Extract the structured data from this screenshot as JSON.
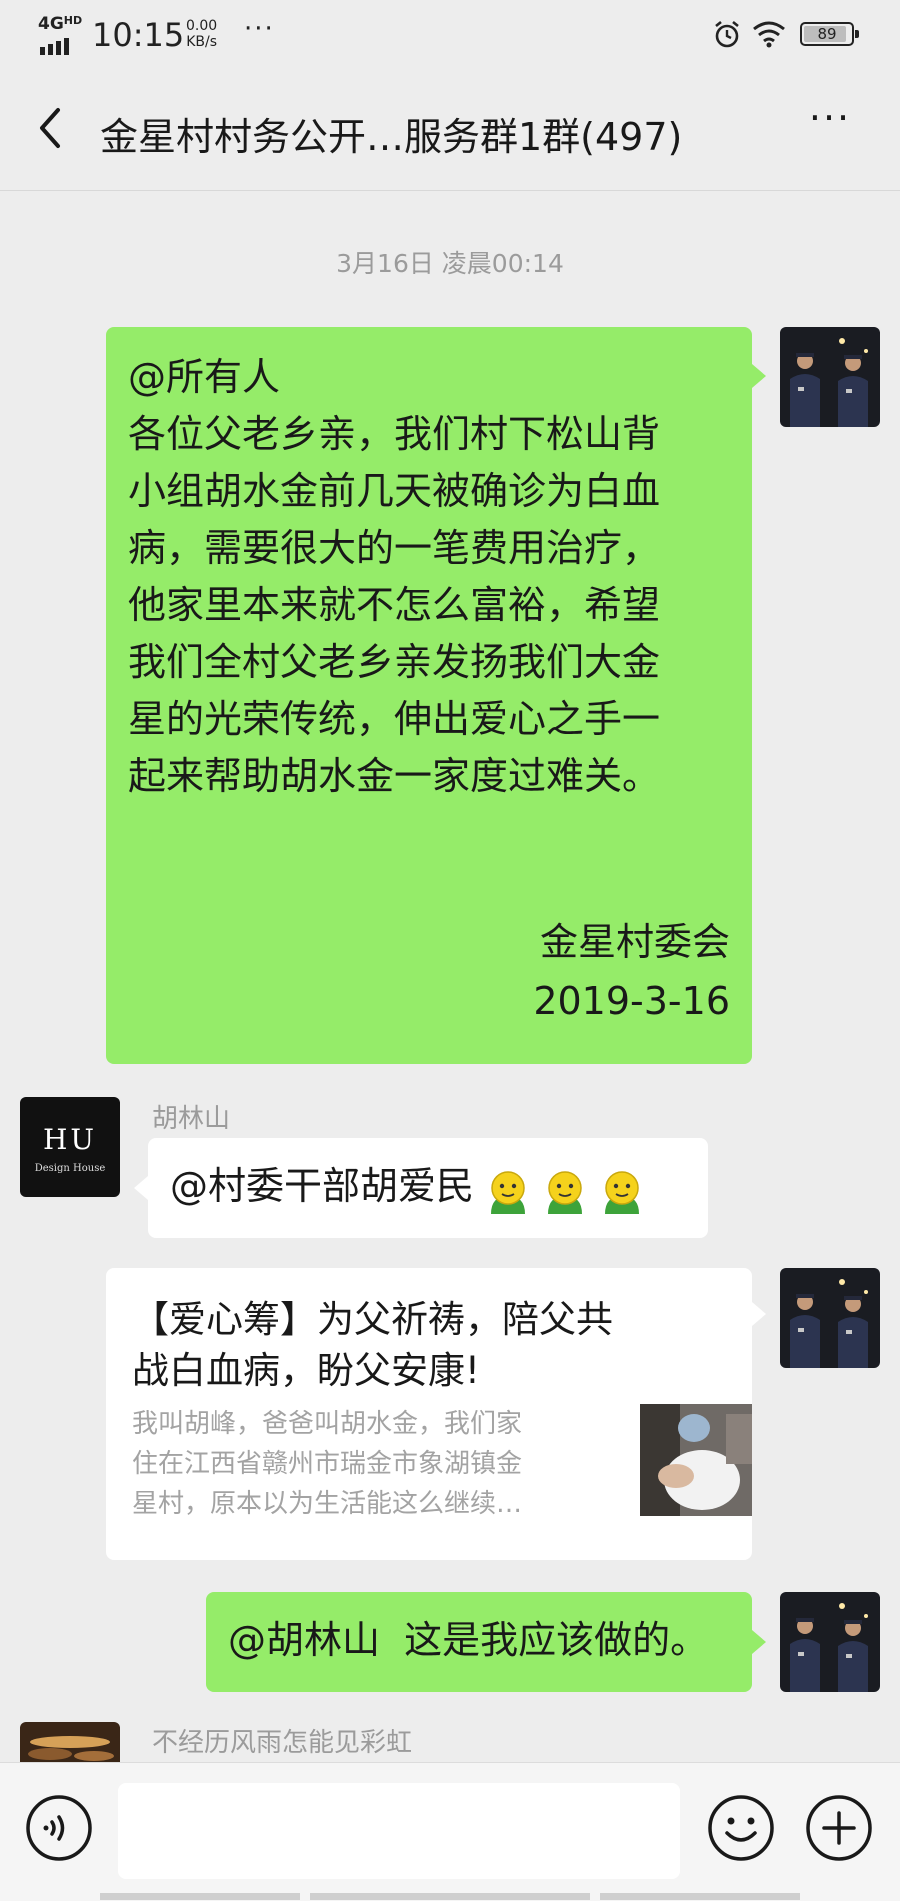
{
  "status_bar": {
    "network": "4G",
    "network_hd": "HD",
    "time": "10:15",
    "speed_value": "0.00",
    "speed_unit": "KB/s",
    "more": "···",
    "battery": "89"
  },
  "header": {
    "title": "金星村村务公开…服务群1群(497)",
    "more_label": "···"
  },
  "chat": {
    "timestamp": "3月16日 凌晨00:14",
    "messages": [
      {
        "lines": [
          "@所有人",
          "各位父老乡亲，我们村下松山背",
          "小组胡水金前几天被确诊为白血",
          "病，需要很大的一笔费用治疗，",
          "他家里本来就不怎么富裕，希望",
          "我们全村父老乡亲发扬我们大金",
          "星的光荣传统，伸出爱心之手一",
          "起来帮助胡水金一家度过难关。"
        ],
        "signature": "金星村委会",
        "date": "2019-3-16"
      },
      {
        "sender": "胡林山",
        "avatar_text": "HU",
        "avatar_sub": "Design House",
        "text": "@村委干部胡爱民"
      },
      {
        "link_title_lines": [
          "【爱心筹】为父祈祷，陪父共",
          "战白血病，盼父安康!"
        ],
        "link_desc_lines": [
          "我叫胡峰，爸爸叫胡水金，我们家",
          "住在江西省赣州市瑞金市象湖镇金",
          "星村，原本以为生活能这么继续…"
        ]
      },
      {
        "text": "@胡林山  这是我应该做的。"
      },
      {
        "sender": "不经历风雨怎能见彩虹"
      }
    ]
  },
  "input": {
    "placeholder": ""
  },
  "colors": {
    "background": "#ededed",
    "bubble_self": "#95ec69",
    "bubble_other": "#ffffff",
    "meta_text": "#9b9b9b"
  },
  "icons": [
    "back-arrow-icon",
    "more-icon",
    "voice-icon",
    "emoji-icon",
    "plus-icon",
    "alarm-icon",
    "wifi-icon",
    "battery-icon"
  ]
}
